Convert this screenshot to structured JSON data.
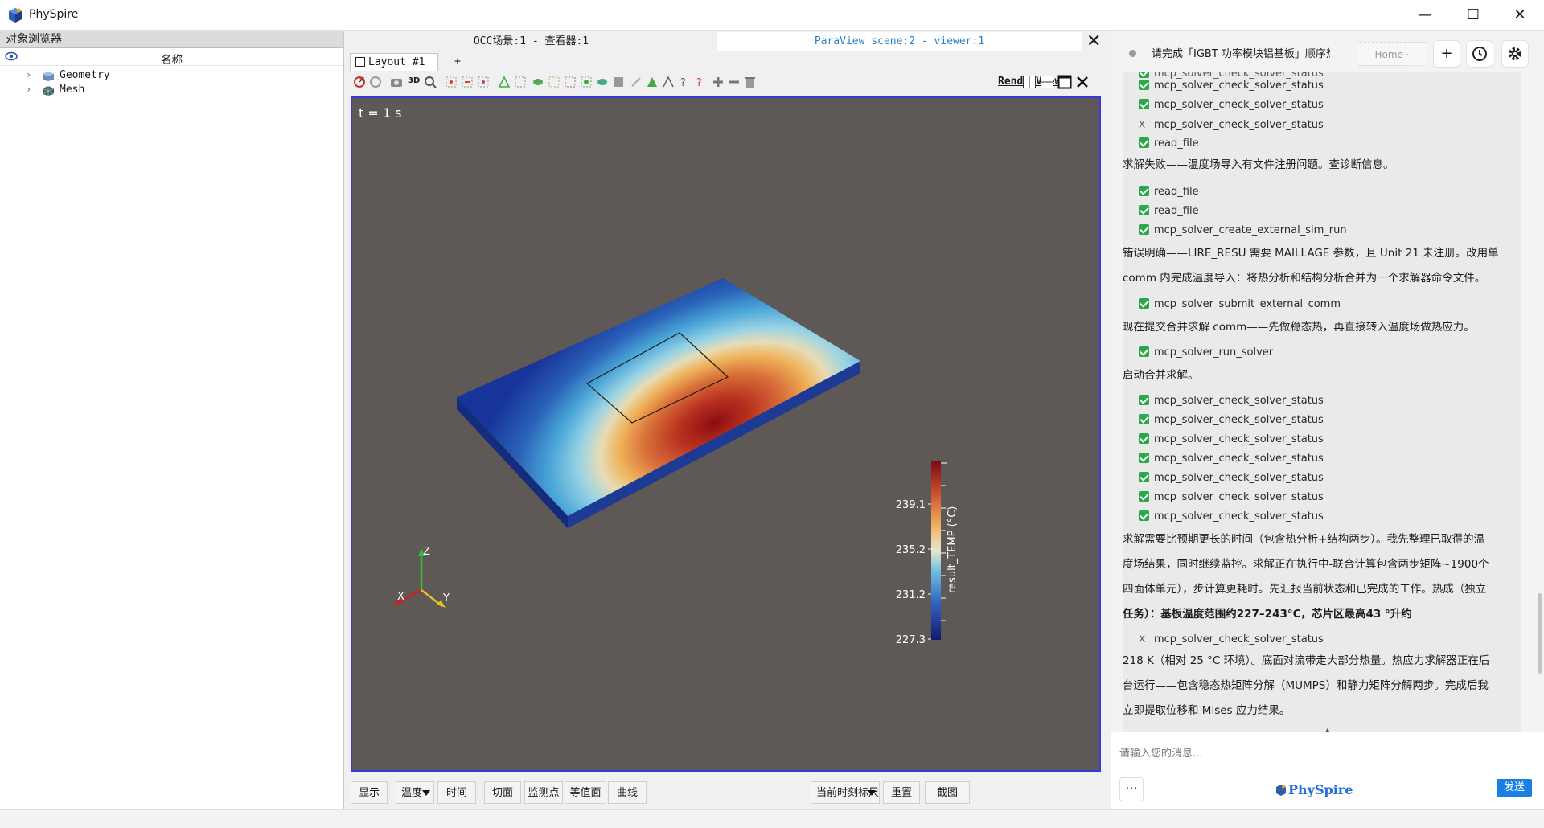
{
  "window": {
    "title": "PhySpire",
    "minimize": "—",
    "maximize": "☐",
    "close": "✕"
  },
  "left_panel": {
    "header": "对象浏览器",
    "column_name": "名称",
    "tree": [
      {
        "label": "Geometry"
      },
      {
        "label": "Mesh"
      }
    ]
  },
  "center": {
    "view_tabs": [
      {
        "label": "OCC场景:1 - 查看器:1"
      },
      {
        "label": "ParaView scene:2 - viewer:1"
      }
    ],
    "view_close": "✕",
    "layout_tab": "Layout #1",
    "layout_tab_close": "✕",
    "layout_add": "+",
    "toolbar_3d": "3D",
    "render_view_label": "RenderView1",
    "time_label": "t = 1 s",
    "colorbar": {
      "title": "result_TEMP (°C)",
      "ticks": [
        "239.1",
        "235.2",
        "231.2",
        "227.3"
      ],
      "range": [
        227.3,
        242.0
      ]
    },
    "axes": {
      "x": "X",
      "y": "Y",
      "z": "Z"
    },
    "bottom_buttons": [
      "显示",
      "温度",
      "时间",
      "切面",
      "监测点",
      "等值面",
      "曲线",
      "当前时刻标尺",
      "重置",
      "截图"
    ]
  },
  "chat": {
    "title": "请完成「IGBT 功率模块铝基板」顺序热·",
    "home_label": "Home ·",
    "new_label": "+",
    "messages": [
      {
        "type": "tool",
        "status": "ok",
        "text": "mcp_solver_check_solver_status"
      },
      {
        "type": "tool",
        "status": "ok",
        "text": "mcp_solver_check_solver_status"
      },
      {
        "type": "tool",
        "status": "fail",
        "text": "mcp_solver_check_solver_status"
      },
      {
        "type": "tool",
        "status": "ok",
        "text": "read_file"
      },
      {
        "type": "text",
        "text": "求解失败——温度场导入有文件注册问题。查诊断信息。"
      },
      {
        "type": "tool",
        "status": "ok",
        "text": "read_file"
      },
      {
        "type": "tool",
        "status": "ok",
        "text": "read_file"
      },
      {
        "type": "tool",
        "status": "ok",
        "text": "mcp_solver_create_external_sim_run"
      },
      {
        "type": "text",
        "text": "错误明确——LIRE_RESU 需要 MAILLAGE 参数，且 Unit 21 未注册。改用单"
      },
      {
        "type": "text",
        "text": "comm 内完成温度导入：将热分析和结构分析合并为一个求解器命令文件。"
      },
      {
        "type": "tool",
        "status": "ok",
        "text": "mcp_solver_submit_external_comm"
      },
      {
        "type": "text",
        "text": "现在提交合并求解 comm——先做稳态热，再直接转入温度场做热应力。"
      },
      {
        "type": "tool",
        "status": "ok",
        "text": "mcp_solver_run_solver"
      },
      {
        "type": "text",
        "text": "启动合并求解。"
      },
      {
        "type": "tool",
        "status": "ok",
        "text": "mcp_solver_check_solver_status"
      },
      {
        "type": "tool",
        "status": "ok",
        "text": "mcp_solver_check_solver_status"
      },
      {
        "type": "tool",
        "status": "ok",
        "text": "mcp_solver_check_solver_status"
      },
      {
        "type": "tool",
        "status": "ok",
        "text": "mcp_solver_check_solver_status"
      },
      {
        "type": "tool",
        "status": "ok",
        "text": "mcp_solver_check_solver_status"
      },
      {
        "type": "tool",
        "status": "ok",
        "text": "mcp_solver_check_solver_status"
      },
      {
        "type": "tool",
        "status": "ok",
        "text": "mcp_solver_check_solver_status"
      },
      {
        "type": "text",
        "text": "求解需要比预期更长的时间（包含热分析+结构两步）。我先整理已取得的温"
      },
      {
        "type": "text",
        "text": "度场结果，同时继续监控。求解正在执行中-联合计算包含两步矩阵~1900个"
      },
      {
        "type": "text",
        "text": "四面体单元），步计算更耗时。先汇报当前状态和已完成的工作。热成（独立"
      },
      {
        "type": "text",
        "text": "任务）：基板温度范围约227–243°C，芯片区最高43 °升约"
      },
      {
        "type": "tool",
        "status": "fail",
        "text": "mcp_solver_check_solver_status"
      },
      {
        "type": "text",
        "text": "218 K（相对 25 °C 环境）。底面对流带走大部分热量。热应力求解器正在后"
      },
      {
        "type": "text",
        "text": "台运行——包含稳态热矩阵分解（MUMPS）和静力矩阵分解两步。完成后我"
      },
      {
        "type": "text",
        "text": "立即提取位移和 Mises 应力结果。"
      }
    ],
    "input_placeholder": "请输入您的消息...",
    "more_label": "···",
    "brand": "PhySpire",
    "send_label": "发送"
  }
}
